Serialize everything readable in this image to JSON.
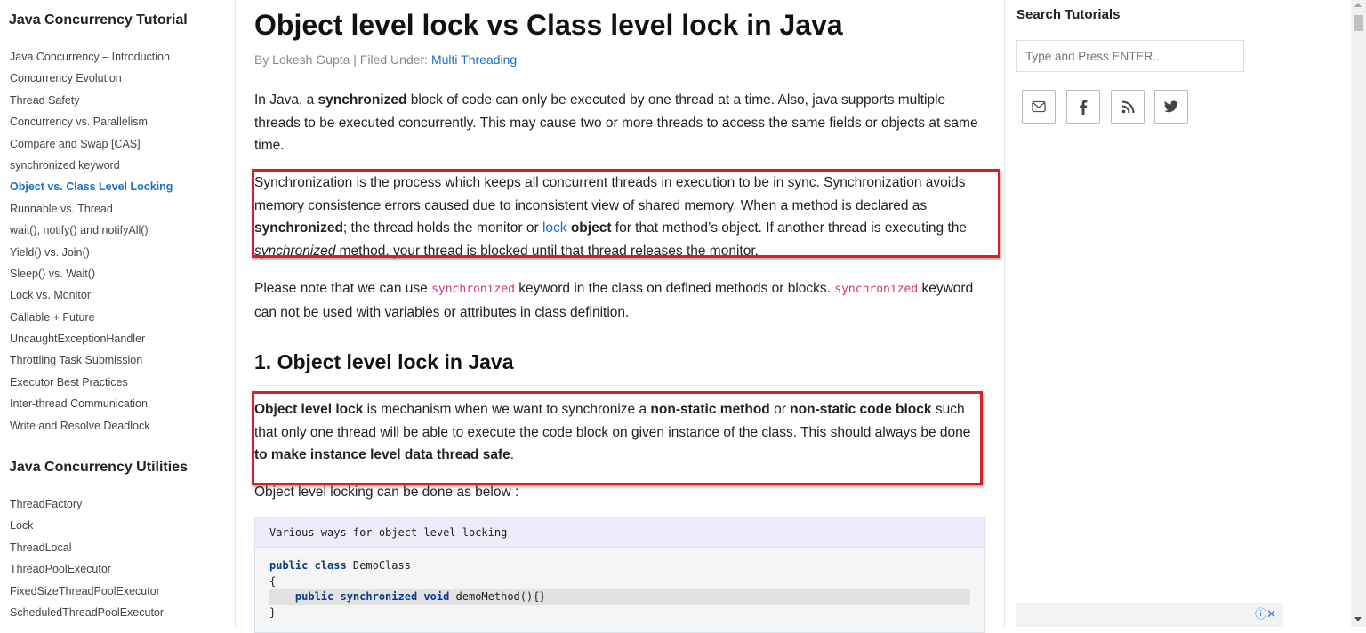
{
  "sidebar": {
    "heading1": "Java Concurrency Tutorial",
    "items1": [
      "Java Concurrency – Introduction",
      "Concurrency Evolution",
      "Thread Safety",
      "Concurrency vs. Parallelism",
      "Compare and Swap [CAS]",
      "synchronized keyword",
      "Object vs. Class Level Locking",
      "Runnable vs. Thread",
      "wait(), notify() and notifyAll()",
      "Yield() vs. Join()",
      "Sleep() vs. Wait()",
      "Lock vs. Monitor",
      "Callable + Future",
      "UncaughtExceptionHandler",
      "Throttling Task Submission",
      "Executor Best Practices",
      "Inter-thread Communication",
      "Write and Resolve Deadlock"
    ],
    "active_item": "Object vs. Class Level Locking",
    "heading2": "Java Concurrency Utilities",
    "items2": [
      "ThreadFactory",
      "Lock",
      "ThreadLocal",
      "ThreadPoolExecutor",
      "FixedSizeThreadPoolExecutor",
      "ScheduledThreadPoolExecutor"
    ]
  },
  "article": {
    "title": "Object level lock vs Class level lock in Java",
    "byline_prefix": "By Lokesh Gupta | Filed Under: ",
    "byline_category": "Multi Threading",
    "p1": {
      "t1": "In Java, a ",
      "b1": "synchronized",
      "t2": " block of code can only be executed by one thread at a time. Also, java supports multiple threads to be executed concurrently. This may cause two or more threads to access the same fields or objects at same time."
    },
    "p2": {
      "t1": "Synchronization is the process which keeps all concurrent threads in execution to be in sync. Synchronization avoids memory consistence errors caused due to inconsistent view of shared memory. When a method is declared as ",
      "b1": "synchronized",
      "t2": "; the thread holds the monitor or ",
      "link": "lock",
      "b2": " object",
      "t3": " for that method’s object. If another thread is executing the ",
      "i1": "synchronized",
      "t4": " method, your thread is blocked until that thread releases the monitor."
    },
    "p3": {
      "t1": "Please note that we can use ",
      "c1": "synchronized",
      "t2": " keyword in the class on defined methods or blocks. ",
      "c2": "synchronized",
      "t3": " keyword can not be used with variables or attributes in class definition."
    },
    "h2": "1. Object level lock in Java",
    "p4": {
      "b1": "Object level lock",
      "t1": " is mechanism when we want to synchronize a ",
      "b2": "non-static method",
      "t2": " or ",
      "b3": "non-static code block",
      "t3": " such that only one thread will be able to execute the code block on given instance of the class. This should always be done ",
      "b4": "to make instance level data thread safe",
      "t4": "."
    },
    "p5": "Object level locking can be done as below :",
    "code": {
      "header": "Various ways for object level locking",
      "line1_kw": "public class",
      "line1_rest": " DemoClass",
      "line2": "{",
      "line3_indent": "    ",
      "line3_kw": "public synchronized void",
      "line3_rest": " demoMethod(){}",
      "line4": "}"
    }
  },
  "rightcol": {
    "search_title": "Search Tutorials",
    "search_placeholder": "Type and Press ENTER...",
    "social": [
      "email-icon",
      "facebook-icon",
      "rss-icon",
      "twitter-icon"
    ],
    "ad_icons": "ⓘ✕"
  },
  "colors": {
    "link": "#1f6fc5",
    "highlight_border": "#d81f26",
    "inline_code": "#d63384",
    "code_keyword": "#0a3c8c"
  }
}
